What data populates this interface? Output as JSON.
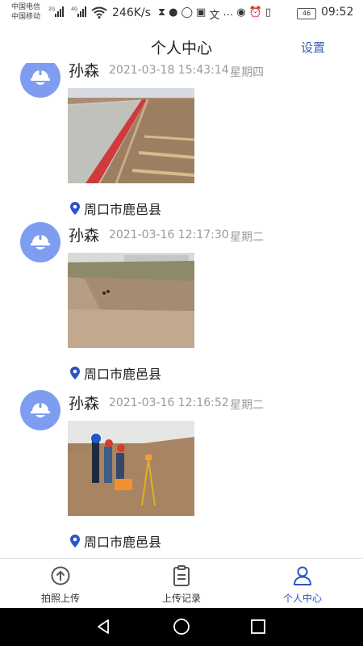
{
  "status_bar": {
    "carrier_1": "中国电信",
    "carrier_2": "中国移动",
    "net_1": "2G",
    "net_2": "4G",
    "speed": "246K/s",
    "battery": "46",
    "time": "09:52"
  },
  "header": {
    "title": "个人中心",
    "settings_label": "设置"
  },
  "entries": [
    {
      "name": "孙森",
      "timestamp": "2021-03-18 15:43:14",
      "weekday": "星期四",
      "location": "周口市鹿邑县"
    },
    {
      "name": "孙森",
      "timestamp": "2021-03-16 12:17:30",
      "weekday": "星期二",
      "location": "周口市鹿邑县"
    },
    {
      "name": "孙森",
      "timestamp": "2021-03-16 12:16:52",
      "weekday": "星期二",
      "location": "周口市鹿邑县"
    }
  ],
  "tabs": [
    {
      "label": "拍照上传",
      "icon": "upload-icon",
      "active": false
    },
    {
      "label": "上传记录",
      "icon": "clipboard-icon",
      "active": false
    },
    {
      "label": "个人中心",
      "icon": "user-icon",
      "active": true
    }
  ],
  "colors": {
    "accent": "#2c54c8",
    "avatar": "#7f9df0",
    "location_pin": "#2c54c8"
  }
}
